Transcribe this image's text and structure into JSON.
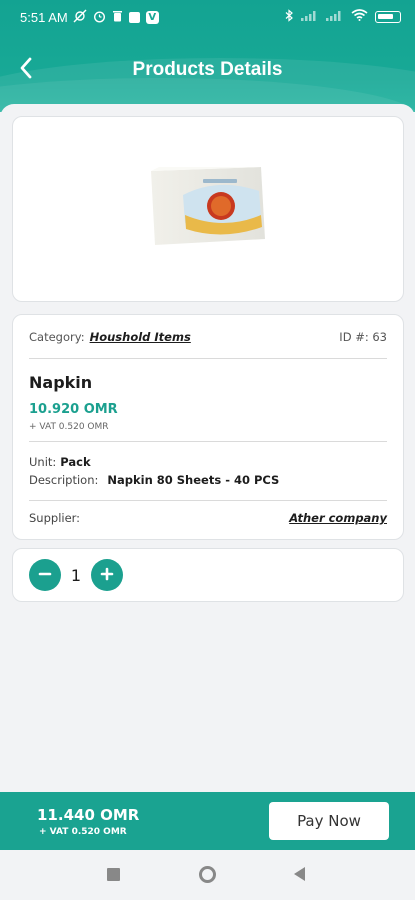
{
  "status_bar": {
    "time": "5:51 AM",
    "icons": [
      "bluetooth-icon",
      "signal-icon",
      "signal-icon",
      "wifi-icon",
      "battery-icon"
    ],
    "battery_level": "99"
  },
  "header": {
    "title": "Products Details",
    "back_icon": "chevron-left-icon"
  },
  "product": {
    "category_label": "Category:",
    "category_value": "Houshold Items",
    "id_label": "ID #: 63",
    "name": "Napkin",
    "price": "10.920  OMR",
    "vat": "+ VAT 0.520  OMR",
    "unit_label": "Unit:",
    "unit_value": "Pack",
    "description_label": "Description:",
    "description_value": "Napkin 80 Sheets - 40 PCS",
    "supplier_label": "Supplier:",
    "supplier_value": "Ather company"
  },
  "quantity": {
    "value": "1",
    "minus_icon": "minus-icon",
    "plus_icon": "plus-icon"
  },
  "footer": {
    "total": "11.440  OMR",
    "total_vat": "+ VAT 0.520  OMR",
    "pay_label": "Pay Now"
  },
  "colors": {
    "accent": "#1aa391",
    "price": "#1ba08f"
  }
}
